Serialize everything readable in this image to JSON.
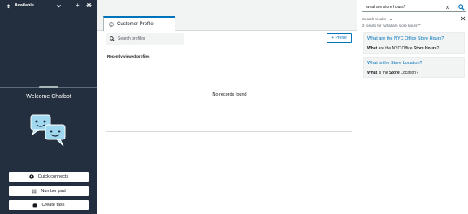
{
  "agent": {
    "status": "Available"
  },
  "left_panel": {
    "welcome": "Welcome Chatbot",
    "buttons": [
      {
        "label": "Quick connects",
        "icon": "user-icon"
      },
      {
        "label": "Number pad",
        "icon": "dialpad-icon"
      },
      {
        "label": "Create task",
        "icon": "briefcase-icon"
      }
    ]
  },
  "center": {
    "tab_label": "Customer Profile",
    "search_placeholder": "Search profiles",
    "add_profile_label": "+ Profile",
    "recent_label": "Recently viewed profiles",
    "empty_message": "No records found"
  },
  "right_panel": {
    "search_value": "what are store hours?",
    "results_header": "Search results",
    "results_count": "2 results for \"what are store hours?\"",
    "results": [
      {
        "question": "What are the NYC Office Store Hours?",
        "answer_parts": [
          {
            "text": "What",
            "bold": true
          },
          {
            "text": " are the NYC Office ",
            "bold": false
          },
          {
            "text": "Store Hours",
            "bold": true
          },
          {
            "text": "?",
            "bold": false
          }
        ]
      },
      {
        "question": "What is the Store Location?",
        "answer_parts": [
          {
            "text": "What",
            "bold": true
          },
          {
            "text": " is the ",
            "bold": false
          },
          {
            "text": "Store",
            "bold": true
          },
          {
            "text": " Location?",
            "bold": false
          }
        ]
      }
    ]
  },
  "colors": {
    "sidebar_bg": "#232f3e",
    "accent": "#0073bb",
    "panel_bg": "#f2f3f3"
  }
}
